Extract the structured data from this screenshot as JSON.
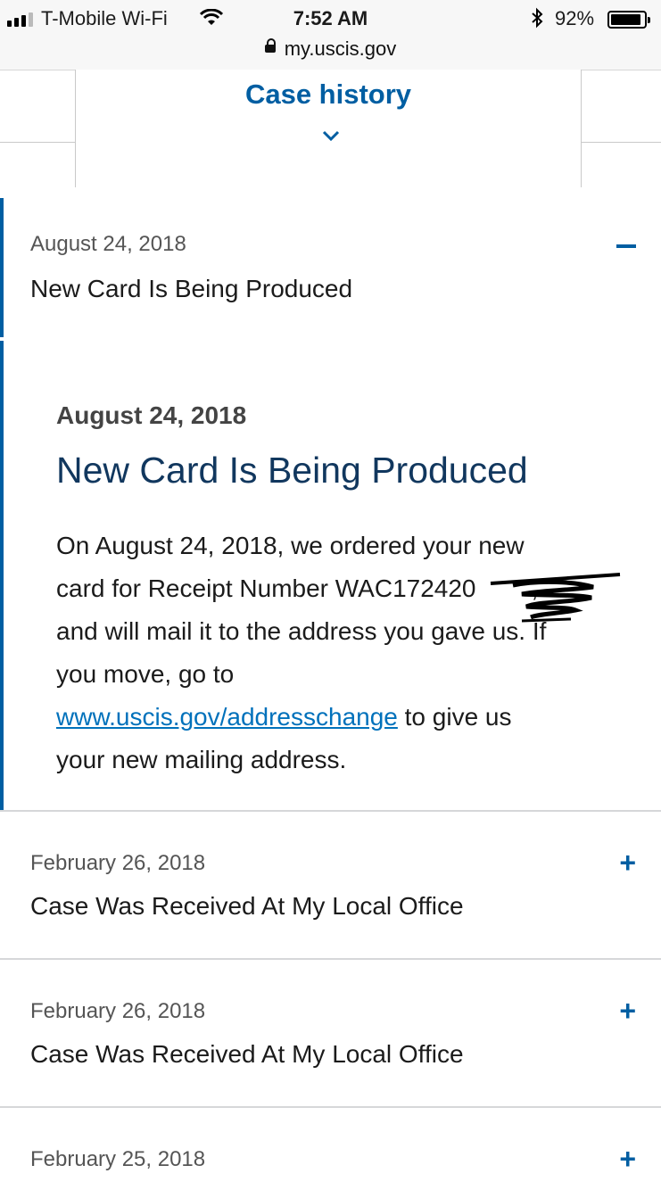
{
  "status_bar": {
    "carrier": "T-Mobile Wi-Fi",
    "time": "7:52 AM",
    "battery": "92%",
    "battery_level": 0.92,
    "icons": [
      "signal-icon",
      "wifi-icon",
      "bluetooth-icon",
      "battery-icon"
    ]
  },
  "browser": {
    "url": "my.uscis.gov",
    "icon": "lock-icon"
  },
  "tab": {
    "title": "Case history",
    "icon": "chevron-down-icon"
  },
  "colors": {
    "accent": "#005ea2",
    "heading": "#11375e",
    "link": "#0071bb"
  },
  "active_event": {
    "date": "August 24, 2018",
    "title": "New Card Is Being Produced",
    "toggle": "collapse-icon",
    "detail": {
      "date": "August 24, 2018",
      "title": "New Card Is Being Produced",
      "body_line1": "On August 24, 2018, we ordered your new",
      "body_line2": "card for Receipt Number WAC172420",
      "body_line2_end": ",",
      "body_line3": "and will mail it to the address you gave us. If",
      "body_line4": "you move, go to",
      "link": "www.uscis.gov/addresschange",
      "body_line5_rest": " to give us",
      "body_line6": "your new mailing address."
    }
  },
  "events": [
    {
      "date": "February 26, 2018",
      "title": "Case Was Received At My Local Office",
      "toggle": "expand-icon"
    },
    {
      "date": "February 26, 2018",
      "title": "Case Was Received At My Local Office",
      "toggle": "expand-icon"
    },
    {
      "date": "February 25, 2018",
      "title": "",
      "toggle": "expand-icon"
    }
  ]
}
